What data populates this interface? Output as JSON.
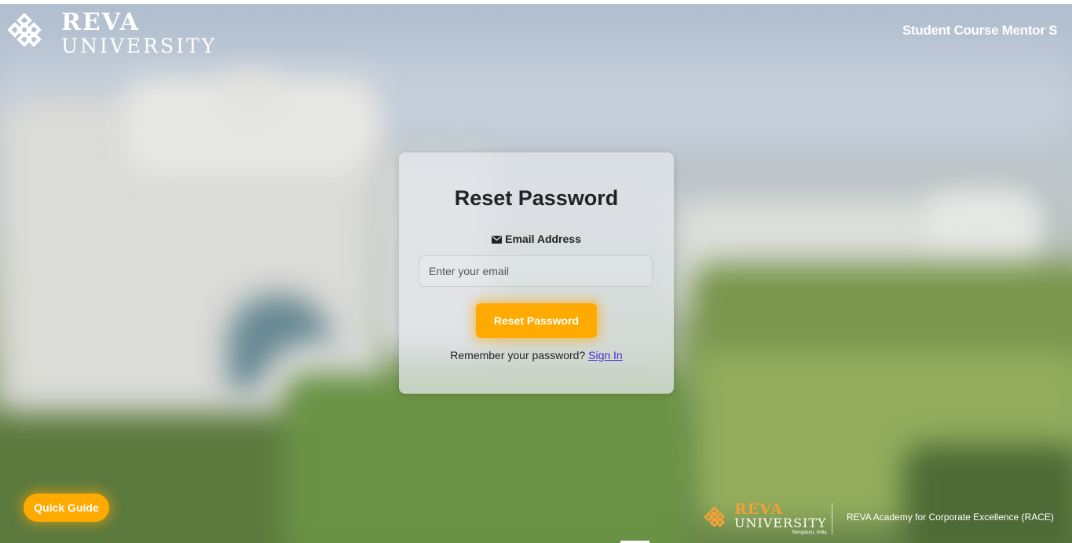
{
  "header": {
    "logo_line1": "REVA",
    "logo_line2": "UNIVERSITY",
    "marquee": "Student Course Mentor S"
  },
  "card": {
    "title": "Reset Password",
    "email_label": "Email Address",
    "email_placeholder": "Enter your email",
    "email_value": "",
    "submit_label": "Reset Password",
    "remember_text": "Remember your password?",
    "signin_label": "Sign In"
  },
  "quick_guide": {
    "label": "Quick Guide"
  },
  "footer": {
    "logo_line1": "REVA",
    "logo_line2": "UNIVERSITY",
    "logo_location": "Bengaluru, India",
    "race_text": "REVA Academy for Corporate Excellence (RACE)"
  },
  "colors": {
    "accent": "#ffaa00",
    "link": "#4a2ad6",
    "footer_logo": "#f0a23a"
  },
  "icons": {
    "logo": "reva-knot-icon",
    "email": "envelope-icon"
  }
}
